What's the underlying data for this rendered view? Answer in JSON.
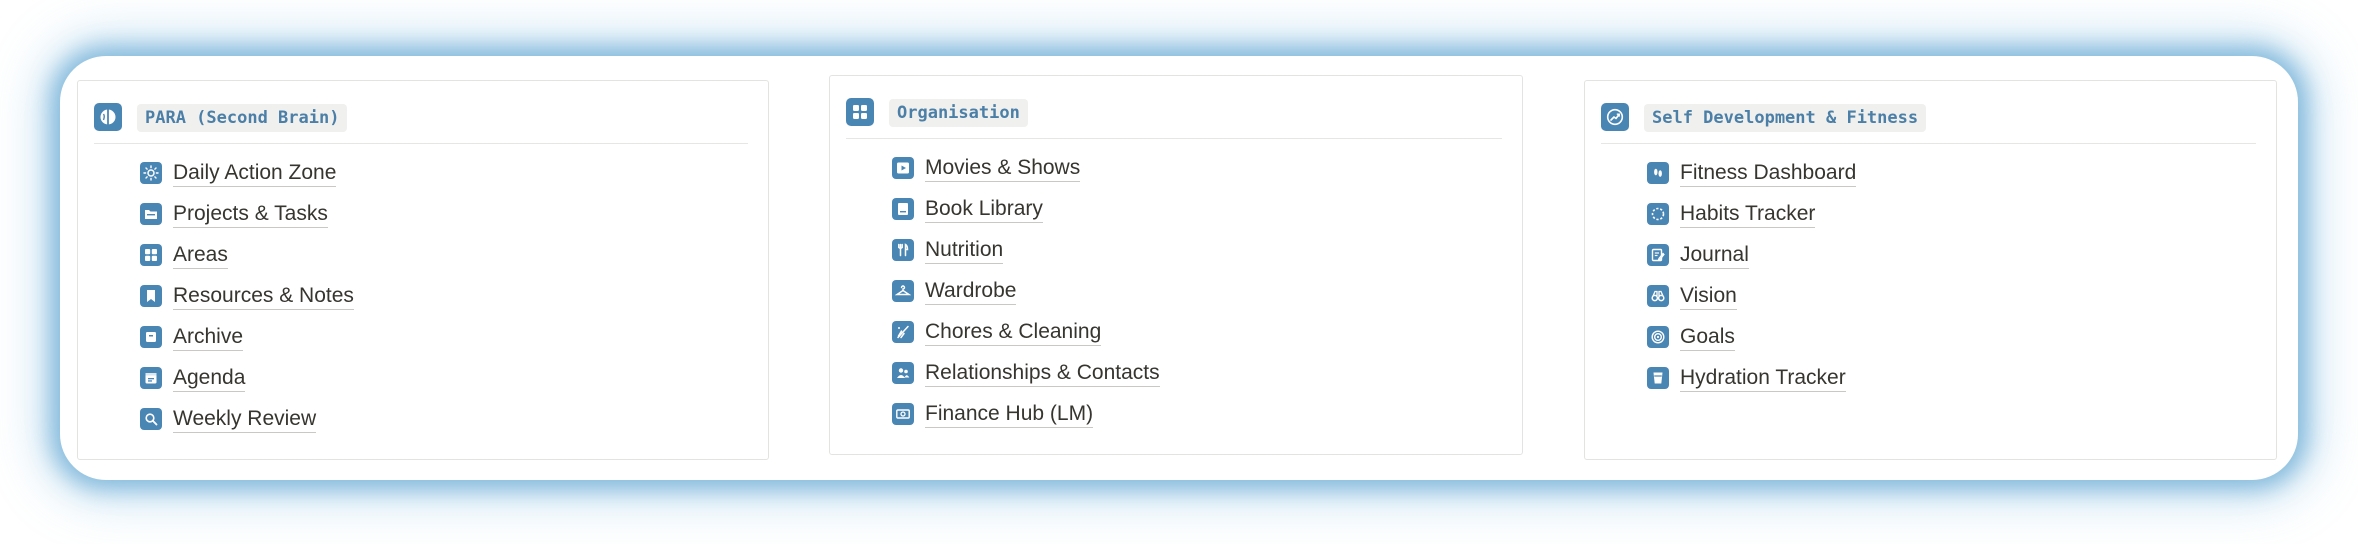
{
  "colors": {
    "accent": "#4a86b4",
    "title_text": "#4b7fa7",
    "item_text": "#37352f",
    "glow": "#4696c8"
  },
  "sections": [
    {
      "title": "PARA (Second Brain)",
      "icon": "brain-icon",
      "items": [
        {
          "label": "Daily Action Zone",
          "icon": "sun-icon"
        },
        {
          "label": "Projects & Tasks",
          "icon": "folder-icon"
        },
        {
          "label": "Areas",
          "icon": "grid-icon"
        },
        {
          "label": "Resources & Notes",
          "icon": "bookmark-icon"
        },
        {
          "label": "Archive",
          "icon": "archive-box-icon"
        },
        {
          "label": "Agenda",
          "icon": "calendar-icon"
        },
        {
          "label": "Weekly Review",
          "icon": "magnifier-icon"
        }
      ]
    },
    {
      "title": "Organisation",
      "icon": "grid-icon",
      "items": [
        {
          "label": "Movies & Shows",
          "icon": "play-icon"
        },
        {
          "label": "Book Library",
          "icon": "book-icon"
        },
        {
          "label": "Nutrition",
          "icon": "fork-knife-icon"
        },
        {
          "label": "Wardrobe",
          "icon": "hanger-icon"
        },
        {
          "label": "Chores & Cleaning",
          "icon": "broom-icon"
        },
        {
          "label": "Relationships & Contacts",
          "icon": "people-icon"
        },
        {
          "label": "Finance Hub (LM)",
          "icon": "banknote-icon"
        }
      ]
    },
    {
      "title": "Self Development & Fitness",
      "icon": "growth-icon",
      "items": [
        {
          "label": "Fitness Dashboard",
          "icon": "footprints-icon"
        },
        {
          "label": "Habits Tracker",
          "icon": "dashed-circle-icon"
        },
        {
          "label": "Journal",
          "icon": "notebook-pen-icon"
        },
        {
          "label": "Vision",
          "icon": "binoculars-icon"
        },
        {
          "label": "Goals",
          "icon": "target-icon"
        },
        {
          "label": "Hydration Tracker",
          "icon": "water-glass-icon"
        }
      ]
    }
  ]
}
